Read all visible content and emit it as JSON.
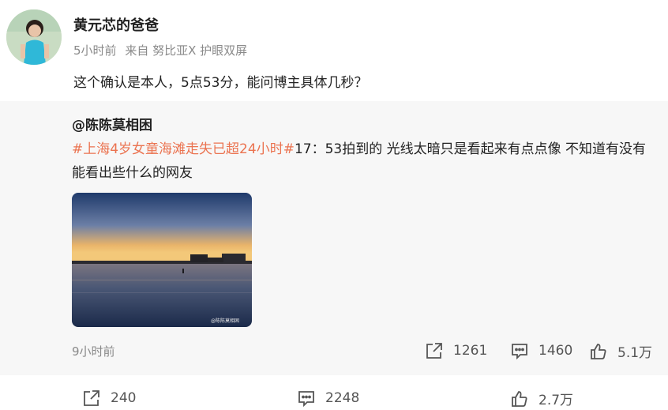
{
  "post": {
    "author": "黄元芯的爸爸",
    "time": "5小时前",
    "source": "来自 努比亚X 护眼双屏",
    "text": "这个确认是本人，5点53分，能问博主具体几秒？"
  },
  "repost": {
    "author": "@陈陈莫相困",
    "hashtag": "#上海4岁女童海滩走失已超24小时#",
    "text_rest": "17：53拍到的   光线太暗只是看起来有点点像   不知道有没有能看出些什么的网友",
    "image_watermark": "@陈陈莫相困",
    "time": "9小时前",
    "actions": {
      "repost_count": "1261",
      "comment_count": "1460",
      "like_count": "5.1万"
    }
  },
  "bottom_actions": {
    "repost_count": "240",
    "comment_count": "2248",
    "like_count": "2.7万"
  }
}
